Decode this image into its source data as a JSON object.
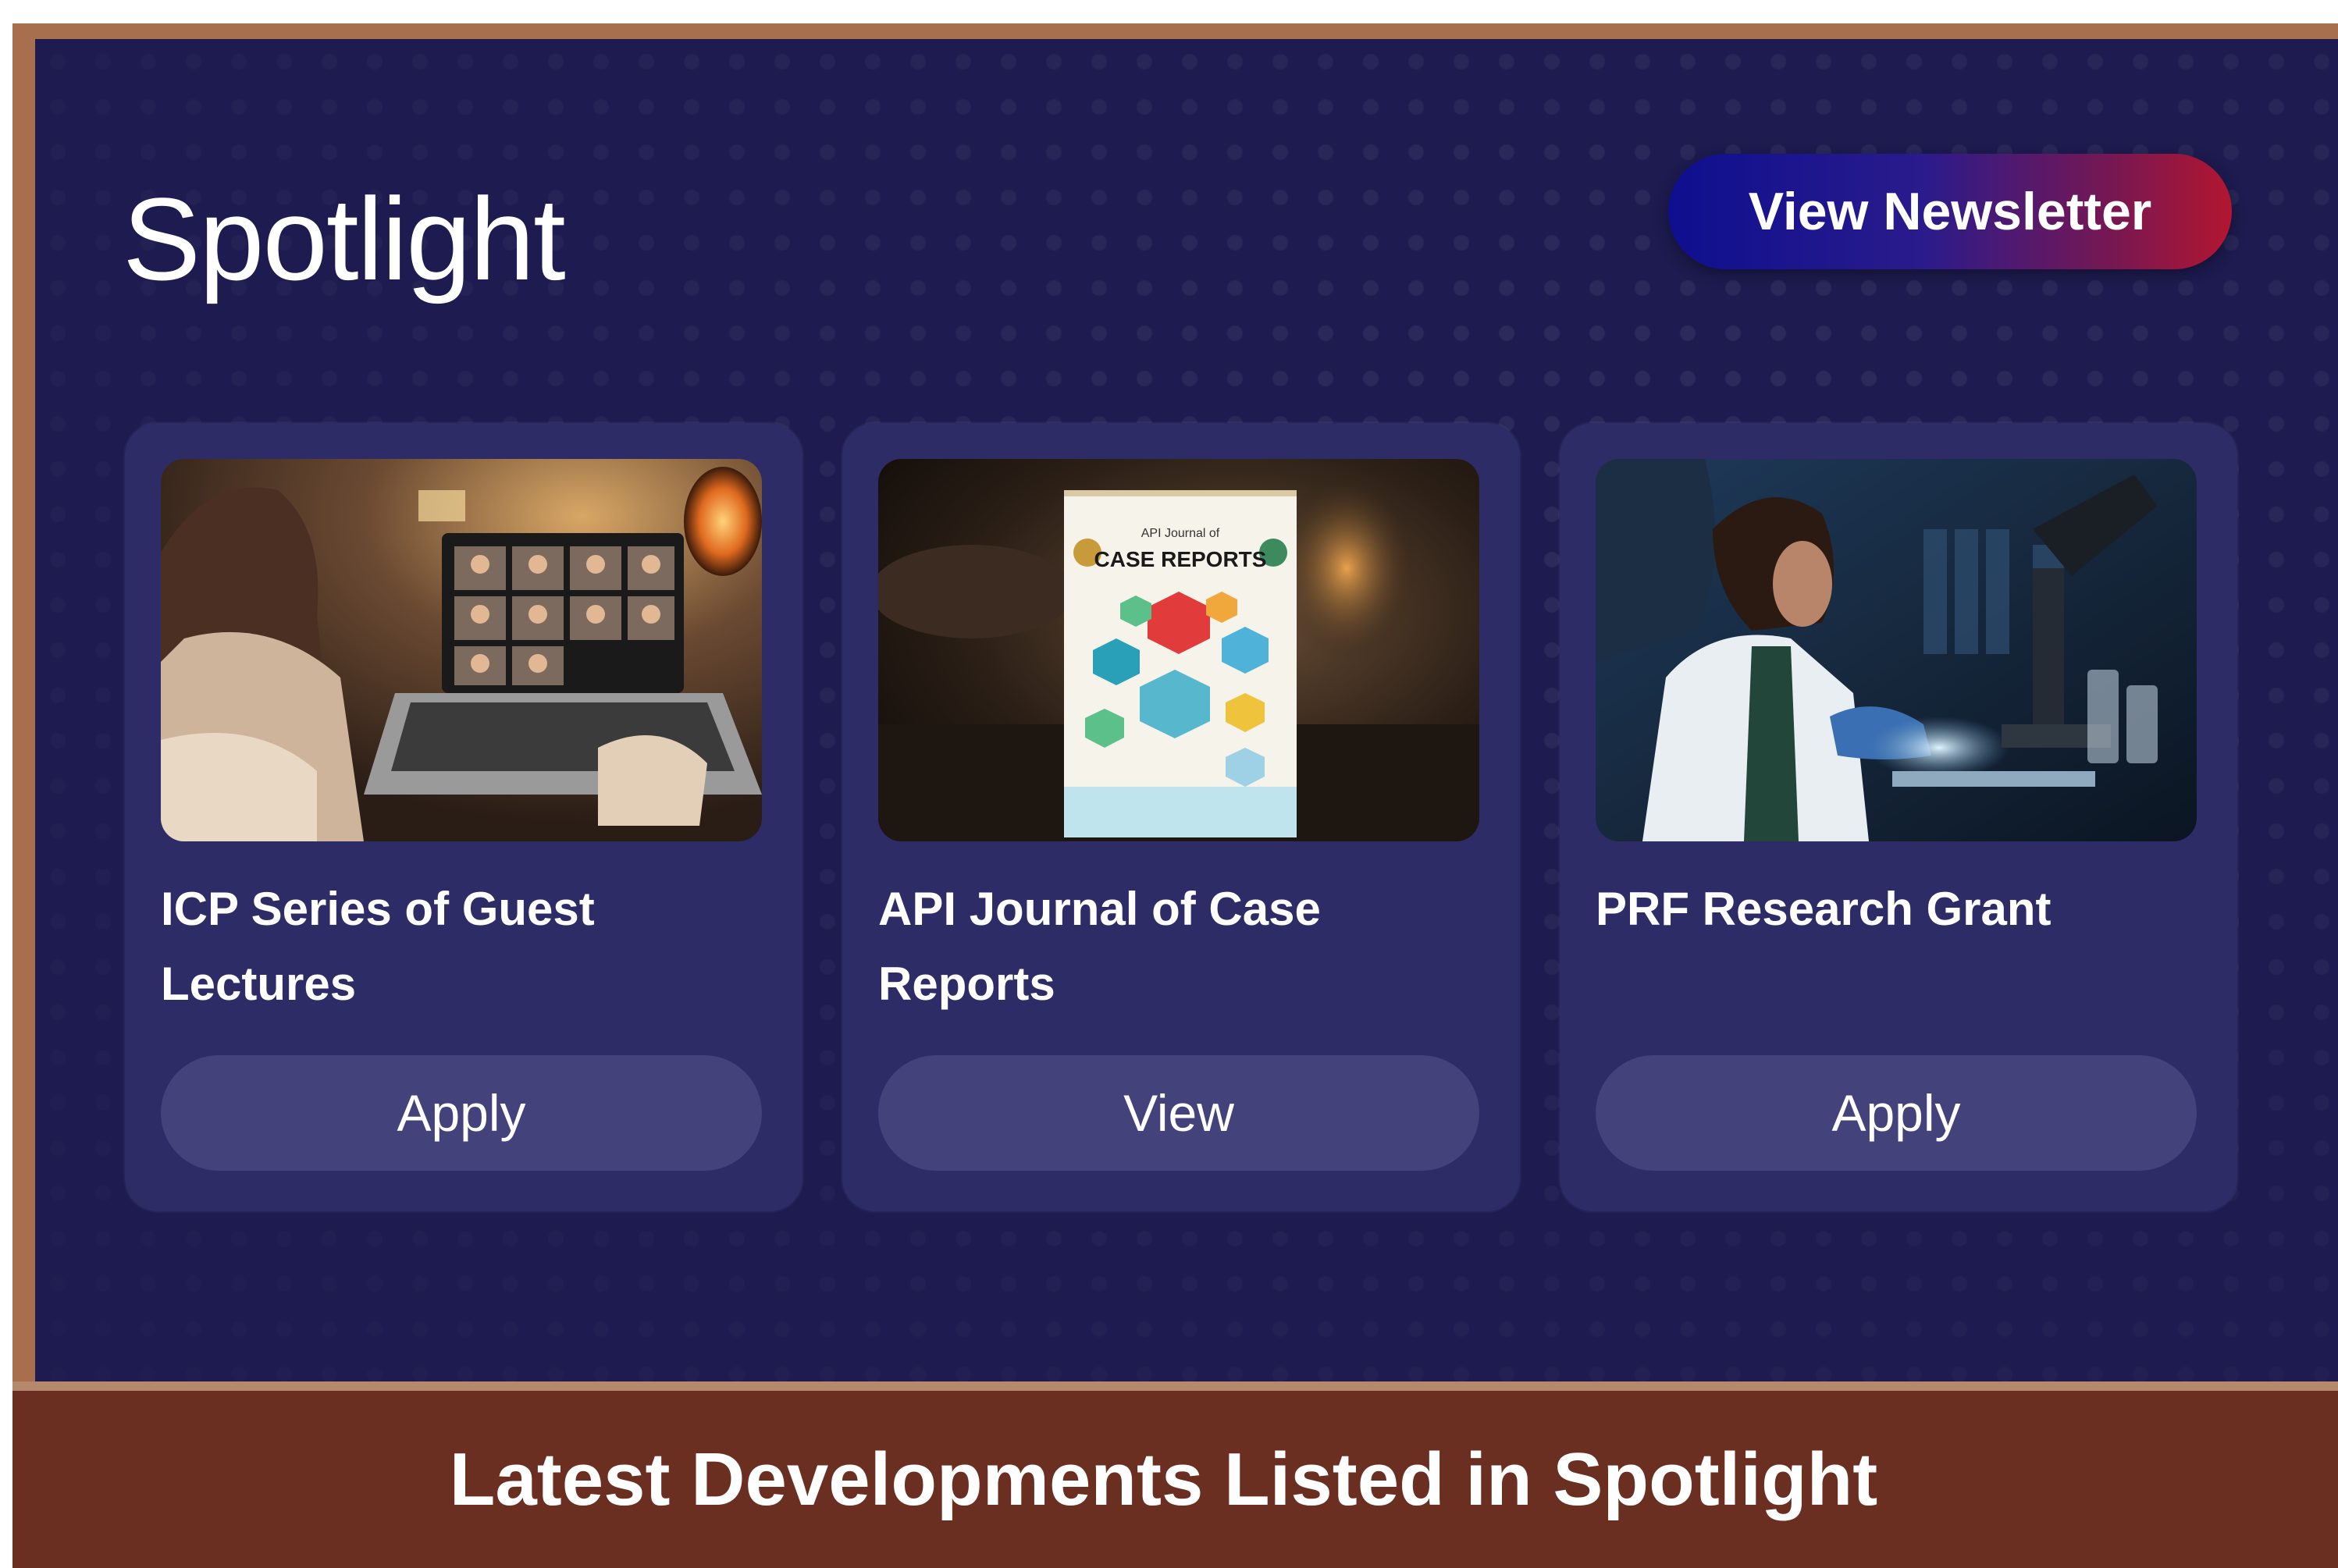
{
  "spotlight": {
    "title": "Spotlight",
    "newsletter_label": "View Newsletter"
  },
  "cards": [
    {
      "title": "ICP Series of Guest Lectures",
      "button": "Apply",
      "image": "video-conference-laptop-image"
    },
    {
      "title": "API Journal of Case Reports",
      "button": "View",
      "image": "journal-cover-image"
    },
    {
      "title": "PRF Research Grant",
      "button": "Apply",
      "image": "scientist-microscope-image"
    }
  ],
  "journal_cover": {
    "heading_small": "API Journal of",
    "heading_large": "CASE REPORTS"
  },
  "banner": {
    "caption": "Latest Developments Listed in Spotlight"
  },
  "colors": {
    "panel": "#1d1b4f",
    "card": "#2d2c66",
    "card_button": "#43427b",
    "banner": "#6b2f22",
    "frame": "#a86f4e",
    "newsletter_gradient_start": "#0e0f8f",
    "newsletter_gradient_end": "#b31630"
  }
}
